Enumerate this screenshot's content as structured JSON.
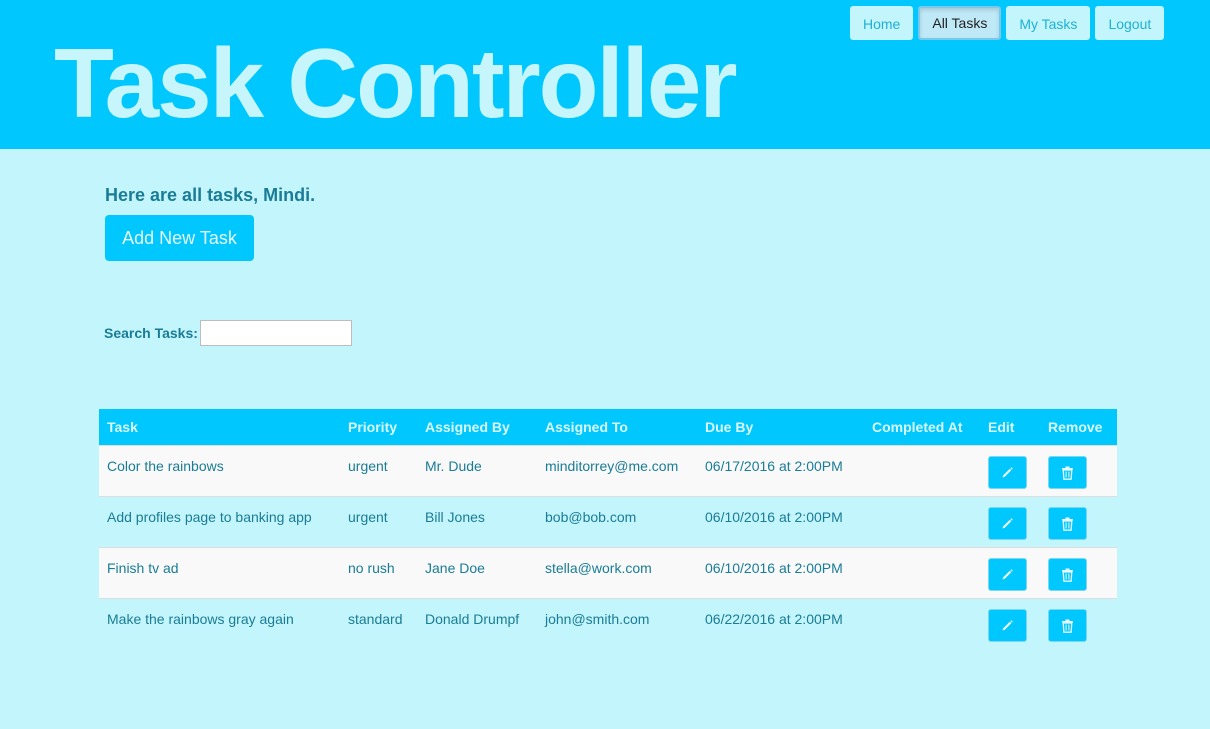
{
  "header": {
    "brand": "Task Controller",
    "nav": [
      {
        "label": "Home",
        "active": false
      },
      {
        "label": "All Tasks",
        "active": true
      },
      {
        "label": "My Tasks",
        "active": false
      },
      {
        "label": "Logout",
        "active": false
      }
    ]
  },
  "main": {
    "greeting": "Here are all tasks, Mindi.",
    "add_button": "Add New Task",
    "search_label": "Search Tasks:",
    "search_value": ""
  },
  "table": {
    "columns": [
      "Task",
      "Priority",
      "Assigned By",
      "Assigned To",
      "Due By",
      "Completed At",
      "Edit",
      "Remove"
    ],
    "rows": [
      {
        "task": "Color the rainbows",
        "priority": "urgent",
        "assigned_by": "Mr. Dude",
        "assigned_to": "minditorrey@me.com",
        "due_by": "06/17/2016 at 2:00PM",
        "completed_at": ""
      },
      {
        "task": "Add profiles page to banking app",
        "priority": "urgent",
        "assigned_by": "Bill Jones",
        "assigned_to": "bob@bob.com",
        "due_by": "06/10/2016 at 2:00PM",
        "completed_at": ""
      },
      {
        "task": "Finish tv ad",
        "priority": "no rush",
        "assigned_by": "Jane Doe",
        "assigned_to": "stella@work.com",
        "due_by": "06/10/2016 at 2:00PM",
        "completed_at": ""
      },
      {
        "task": "Make the rainbows gray again",
        "priority": "standard",
        "assigned_by": "Donald Drumpf",
        "assigned_to": "john@smith.com",
        "due_by": "06/22/2016 at 2:00PM",
        "completed_at": ""
      }
    ],
    "edit_icon": "pencil-icon",
    "remove_icon": "trash-icon"
  },
  "colors": {
    "accent": "#00c7fe",
    "background": "#c3f5fc",
    "text": "#1a7c96"
  }
}
